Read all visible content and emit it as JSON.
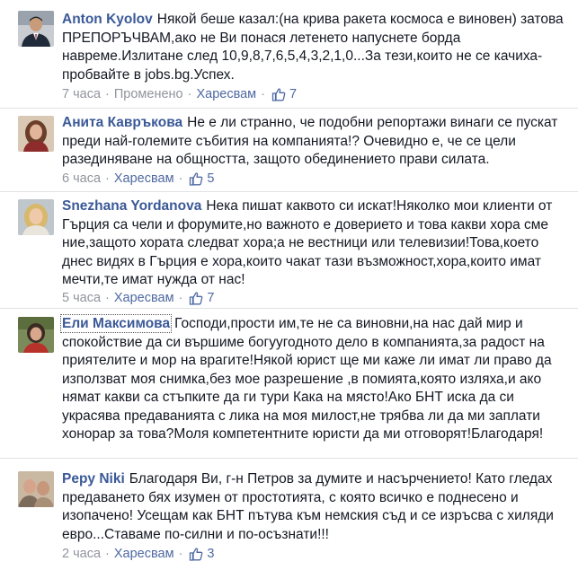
{
  "comments": [
    {
      "author": "Anton Kyolov",
      "text": "Някой беше казал:(на крива ракета космоса е виновен) затова ПРЕПОРЪЧВАМ,ако не Ви понася летенето напуснете борда навреме.Излитане след 10,9,8,7,6,5,4,3,2,1,0...За тези,които не се качиха-пробвайте в jobs.bg.Успех.",
      "time": "7 часа",
      "edited": "Променено",
      "like_label": "Харесвам",
      "likes": "7"
    },
    {
      "author": "Анита Кавръкова",
      "text": "Не е ли странно, че подобни репортажи винаги се пускат преди най-големите събития на компанията!? Очевидно е, че се цели разединяване на общността, защото обединението прави силата.",
      "time": "6 часа",
      "like_label": "Харесвам",
      "likes": "5"
    },
    {
      "author": "Snezhana Yordanova",
      "text": "Нека пишат каквото си искат!Няколко мои клиенти от Гърция са чели и форумите,но важното е доверието и това какви хора сме ние,защото хората следват хора;а не вестници или телевизии!Това,което днес видях в Гърция е хора,които чакат тази възможност,хора,които имат мечти,те имат нужда от нас!",
      "time": "5 часа",
      "like_label": "Харесвам",
      "likes": "7"
    },
    {
      "author": "Ели Максимова",
      "text": "Господи,прости им,те не са виновни,на нас дай мир и спокойствие да си вършиме богуугодното дело в компанията,за радост на приятелите и мор на врагите!Някой юрист ще ми каже ли имат ли право да използват моя снимка,без мое разрешение ,в помията,която изляха,и ако нямат какви са стъпките да ги тури Кака на място!Ако БНТ иска да си украсява предаванията с лика на моя милост,не трябва ли да ми заплати хонорар за това?Моля компетентните юристи да ми отговорят!Благодаря!",
      "time": "",
      "like_label": "",
      "likes": ""
    },
    {
      "author": "Pepy Niki",
      "text": "Благодаря Ви, г-н Петров за думите и насърчението! Като гледах предаването бях изумен от простотията, с която всичко е поднесено и изопачено! Усещам как БНТ пътува към немския съд и се изръсва с хиляди евро...Ставаме по-силни и по-осъзнати!!!",
      "time": "2 часа",
      "like_label": "Харесвам",
      "likes": "3"
    }
  ],
  "colors": {
    "author": "#3b5998",
    "link": "#4e69a2",
    "meta": "#90949c",
    "text": "#141823",
    "separator": "#e1e2e3"
  }
}
